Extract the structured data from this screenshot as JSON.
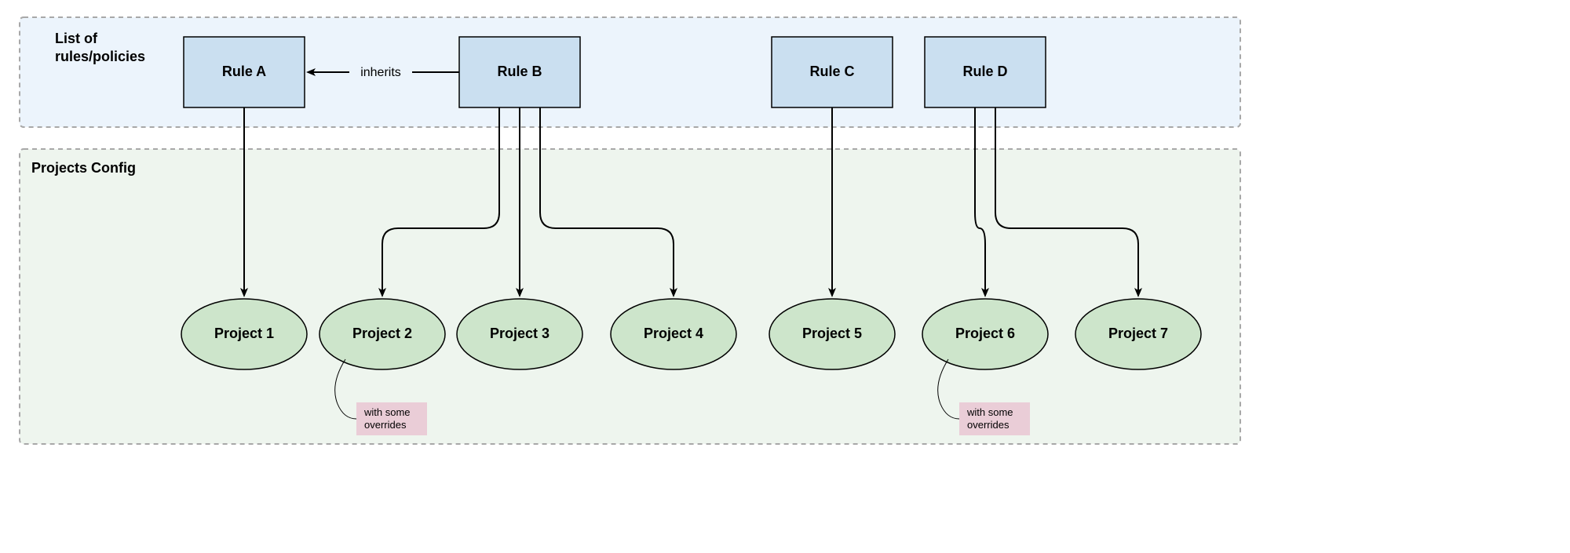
{
  "regions": {
    "topTitleLine1": "List of",
    "topTitleLine2": "rules/policies",
    "bottomTitle": "Projects Config"
  },
  "rules": {
    "a": "Rule A",
    "b": "Rule B",
    "c": "Rule C",
    "d": "Rule D"
  },
  "projects": {
    "p1": "Project 1",
    "p2": "Project 2",
    "p3": "Project 3",
    "p4": "Project 4",
    "p5": "Project 5",
    "p6": "Project 6",
    "p7": "Project 7"
  },
  "edges": {
    "inherits": "inherits"
  },
  "notes": {
    "overrideLine1": "with some",
    "overrideLine2": "overrides"
  }
}
